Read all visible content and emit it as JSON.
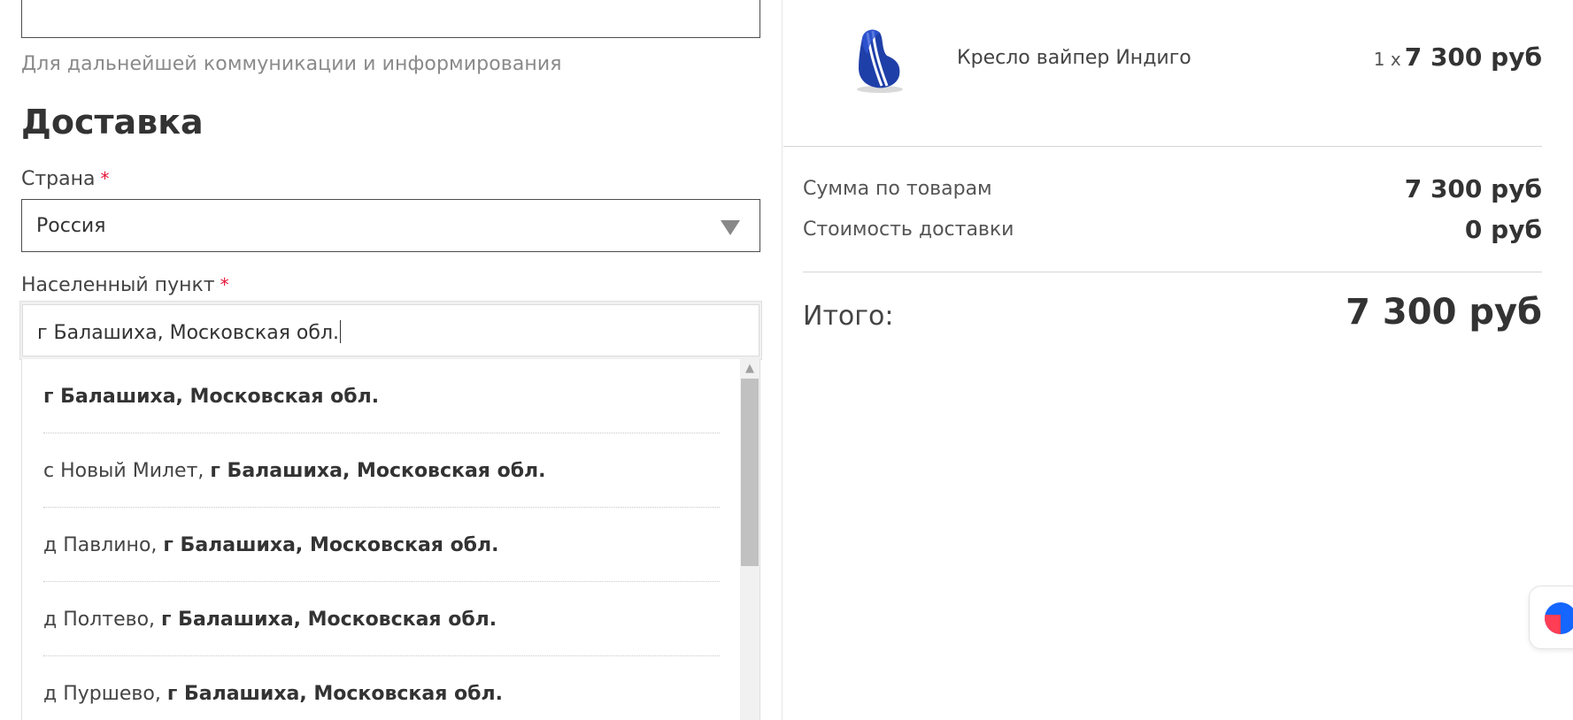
{
  "form": {
    "contact_hint": "Для дальнейшей коммуникации и информирования",
    "delivery_title": "Доставка",
    "country_label": "Страна",
    "country_required_mark": "*",
    "country_value": "Россия",
    "city_label": "Населенный пункт",
    "city_required_mark": "*",
    "city_value": "г Балашиха, Московская обл."
  },
  "suggestions": [
    {
      "prefix": "",
      "main": "г Балашиха, Московская обл."
    },
    {
      "prefix": "с Новый Милет, ",
      "main": "г Балашиха, Московская обл."
    },
    {
      "prefix": "д Павлино, ",
      "main": "г Балашиха, Московская обл."
    },
    {
      "prefix": "д Полтево, ",
      "main": "г Балашиха, Московская обл."
    },
    {
      "prefix": "д Пуршево, ",
      "main": "г Балашиха, Московская обл."
    }
  ],
  "cart": {
    "product_name": "Кресло вайпер Индиго",
    "product_qty": "1 x",
    "product_price": "7 300 руб",
    "goods_sum_label": "Сумма по товарам",
    "goods_sum_value": "7 300 руб",
    "delivery_cost_label": "Стоимость доставки",
    "delivery_cost_value": "0 руб",
    "total_label": "Итого:",
    "total_value": "7 300 руб"
  },
  "colors": {
    "accent_required": "#e4163a",
    "text_primary": "#333333",
    "text_hint": "#8a8a8a",
    "product_blue": "#1f3fa8"
  },
  "icons": {
    "select_arrow": "triangle-down",
    "chat_widget": "chat-bubble-icon",
    "scroll_up": "chevron-up"
  }
}
